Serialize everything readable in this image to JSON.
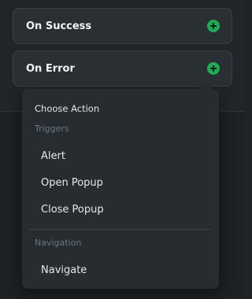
{
  "events": [
    {
      "label": "On Success",
      "icon": "plus-circle-icon"
    },
    {
      "label": "On Error",
      "icon": "plus-circle-icon"
    }
  ],
  "dropdown": {
    "title": "Choose Action",
    "sections": [
      {
        "label": "Triggers",
        "items": [
          "Alert",
          "Open Popup",
          "Close Popup"
        ]
      },
      {
        "label": "Navigation",
        "items": [
          "Navigate"
        ]
      }
    ]
  },
  "colors": {
    "accent": "#1faa55",
    "background": "#1f2326",
    "row_background": "#2a2f33",
    "dropdown_background": "#272c30"
  }
}
